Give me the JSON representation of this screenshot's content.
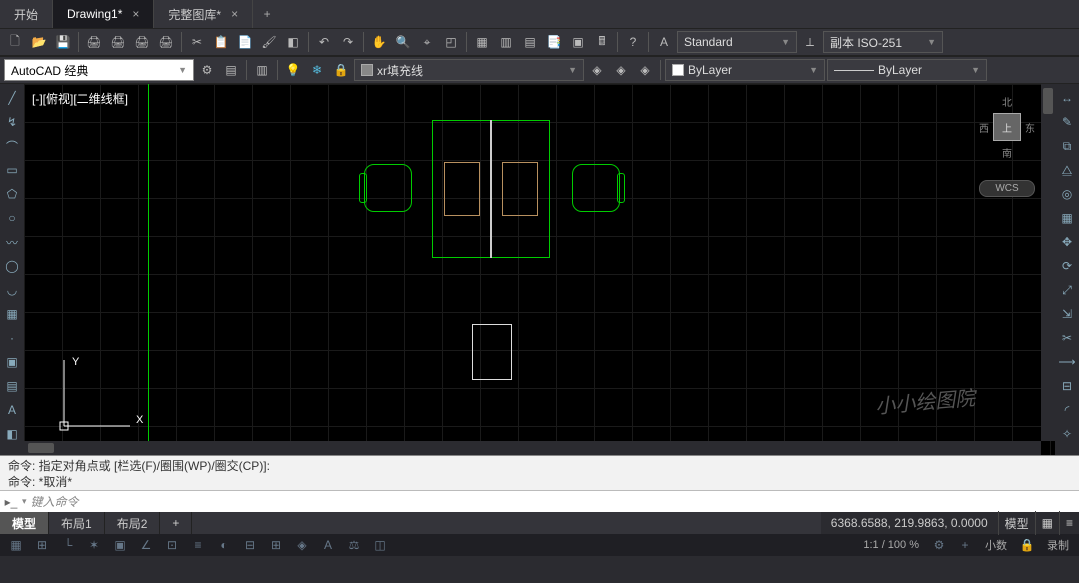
{
  "tabs": {
    "items": [
      {
        "label": "开始",
        "closeable": false,
        "active": false
      },
      {
        "label": "Drawing1*",
        "closeable": true,
        "active": true
      },
      {
        "label": "完整图库*",
        "closeable": true,
        "active": false
      }
    ],
    "plus": "+"
  },
  "toolbar": {
    "text_style": "Standard",
    "dim_style": "副本 ISO-251"
  },
  "workspace": {
    "select_label": "AutoCAD 经典",
    "layer_name": "xr填充线",
    "linetype": "ByLayer",
    "lineweight": "ByLayer"
  },
  "viewport": {
    "label": "[-][俯视][二维线框]",
    "wcs": "WCS",
    "viewcube": {
      "north": "北",
      "south": "南",
      "east": "东",
      "west": "西",
      "top": "上"
    },
    "ucs": {
      "x": "X",
      "y": "Y"
    }
  },
  "watermark": "小小绘图院",
  "command": {
    "history_line1": "命令:  指定对角点或 [栏选(F)/圈围(WP)/圈交(CP)]:",
    "history_line2": "命令:  *取消*",
    "prompt_placeholder": "键入命令",
    "chevron": "▾"
  },
  "model_tabs": {
    "items": [
      {
        "label": "模型",
        "active": true
      },
      {
        "label": "布局1",
        "active": false
      },
      {
        "label": "布局2",
        "active": false
      }
    ],
    "plus": "+"
  },
  "status": {
    "coords": "6368.6588, 219.9863, 0.0000",
    "mode": "模型",
    "grid_icon": "▦",
    "menu_icon": "≡"
  },
  "tray": {
    "zoom": "1:1 / 100 %",
    "decimal": "小数",
    "record": "录制"
  }
}
